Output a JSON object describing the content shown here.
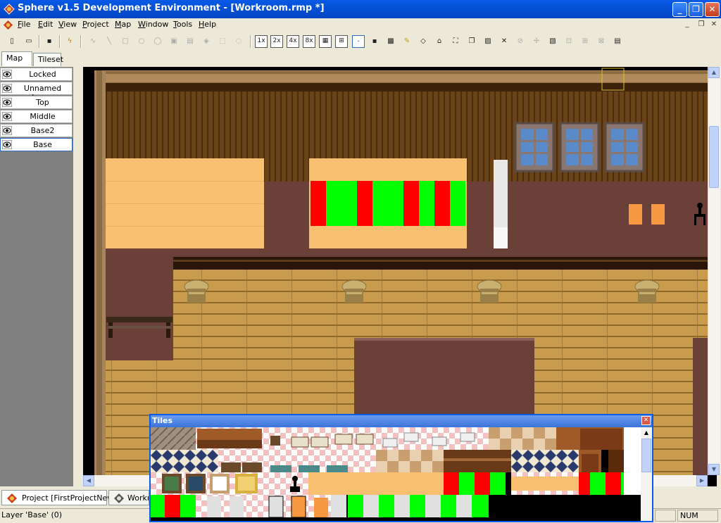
{
  "window": {
    "title": "Sphere v1.5 Development Environment - [Workroom.rmp *]",
    "minimize_label": "_",
    "maximize_label": "❐",
    "close_label": "✕"
  },
  "menubar": {
    "items": [
      {
        "pre": "",
        "u": "F",
        "post": "ile"
      },
      {
        "pre": "",
        "u": "E",
        "post": "dit"
      },
      {
        "pre": "",
        "u": "V",
        "post": "iew"
      },
      {
        "pre": "",
        "u": "P",
        "post": "roject"
      },
      {
        "pre": "",
        "u": "M",
        "post": "ap"
      },
      {
        "pre": "",
        "u": "W",
        "post": "indow"
      },
      {
        "pre": "",
        "u": "T",
        "post": "ools"
      },
      {
        "pre": "",
        "u": "H",
        "post": "elp"
      }
    ],
    "mdi_min": "_",
    "mdi_restore": "❐",
    "mdi_close": "✕"
  },
  "toolbar": {
    "zoom_labels": [
      "1x",
      "2x",
      "4x",
      "8x"
    ]
  },
  "tabs": {
    "map": "Map",
    "tileset": "Tileset"
  },
  "layers": [
    {
      "name": "Locked"
    },
    {
      "name": "Unnamed Layer"
    },
    {
      "name": "Top"
    },
    {
      "name": "Middle"
    },
    {
      "name": "Base2"
    },
    {
      "name": "Base"
    }
  ],
  "tiles_window": {
    "title": "Tiles"
  },
  "doctabs": {
    "project": "Project [FirstProjectNew]",
    "workroom": "Workr"
  },
  "statusbar": {
    "layer": "Layer 'Base' (0)",
    "num": "NUM"
  },
  "colors": {
    "accent": "#0a5ae8",
    "wall_wood": "#5e3a14",
    "floor_wood": "#c49a4a",
    "carpet": "#6b3f38",
    "orange_block": "#f8c070",
    "red": "#ff0000",
    "green": "#00ff00"
  }
}
